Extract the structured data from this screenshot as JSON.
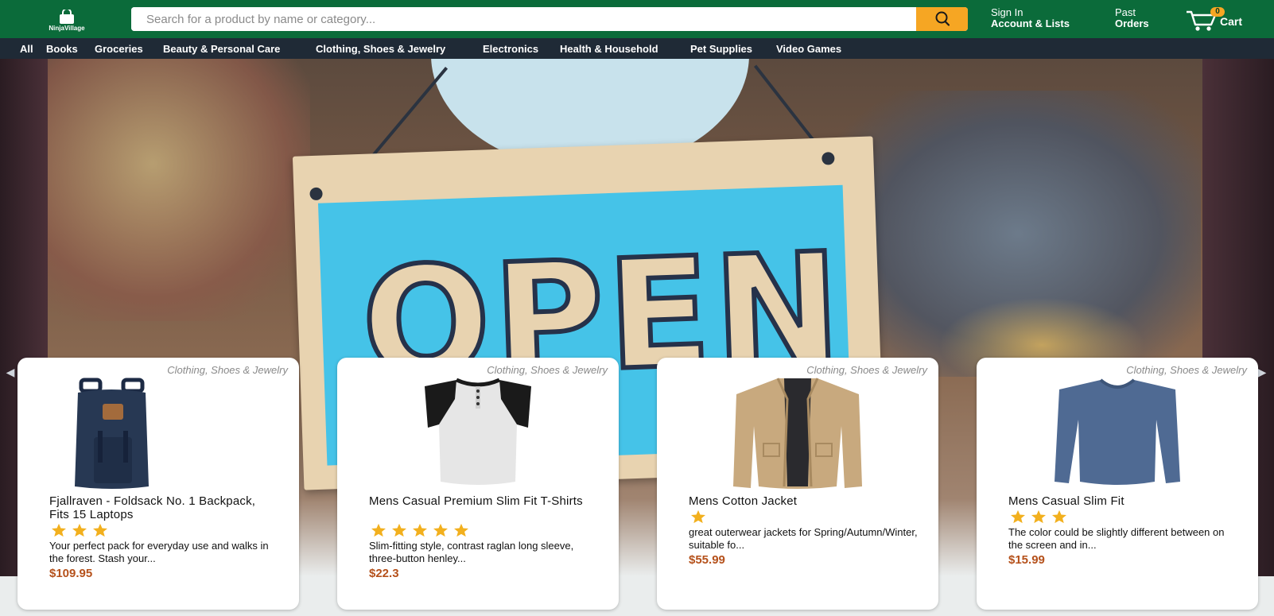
{
  "brand": {
    "name": "NinjaVillage"
  },
  "search": {
    "placeholder": "Search for a product by name or category..."
  },
  "account": {
    "line1": "Sign In",
    "line2": "Account & Lists"
  },
  "orders": {
    "line1": "Past",
    "line2": "Orders"
  },
  "cart": {
    "count": "0",
    "label": "Cart"
  },
  "categories": [
    "All",
    "Books",
    "Groceries",
    "Beauty & Personal Care",
    "Clothing, Shoes & Jewelry",
    "Electronics",
    "Health & Household",
    "Pet Supplies",
    "Video Games"
  ],
  "hero": {
    "sign_word": "OPEN"
  },
  "products": [
    {
      "category": "Clothing, Shoes & Jewelry",
      "title": "Fjallraven - Foldsack No. 1 Backpack, Fits 15 Laptops",
      "rating": 3,
      "description": "Your perfect pack for everyday use and walks in the forest. Stash your...",
      "price": "$109.95",
      "image_icon": "backpack-icon"
    },
    {
      "category": "Clothing, Shoes & Jewelry",
      "title": "Mens Casual Premium Slim Fit T-Shirts",
      "rating": 5,
      "description": "Slim-fitting style, contrast raglan long sleeve, three-button henley...",
      "price": "$22.3",
      "image_icon": "henley-shirt-icon"
    },
    {
      "category": "Clothing, Shoes & Jewelry",
      "title": "Mens Cotton Jacket",
      "rating": 1,
      "description": "great outerwear jackets for Spring/Autumn/Winter, suitable fo...",
      "price": "$55.99",
      "image_icon": "jacket-icon"
    },
    {
      "category": "Clothing, Shoes & Jewelry",
      "title": "Mens Casual Slim Fit",
      "rating": 3,
      "description": "The color could be slightly different between on the screen and in...",
      "price": "$15.99",
      "image_icon": "long-sleeve-shirt-icon"
    }
  ],
  "colors": {
    "header": "#0b6b3a",
    "subnav": "#1f2a36",
    "accent": "#f6a623",
    "price": "#b5511b",
    "star": "#f2b01e"
  }
}
